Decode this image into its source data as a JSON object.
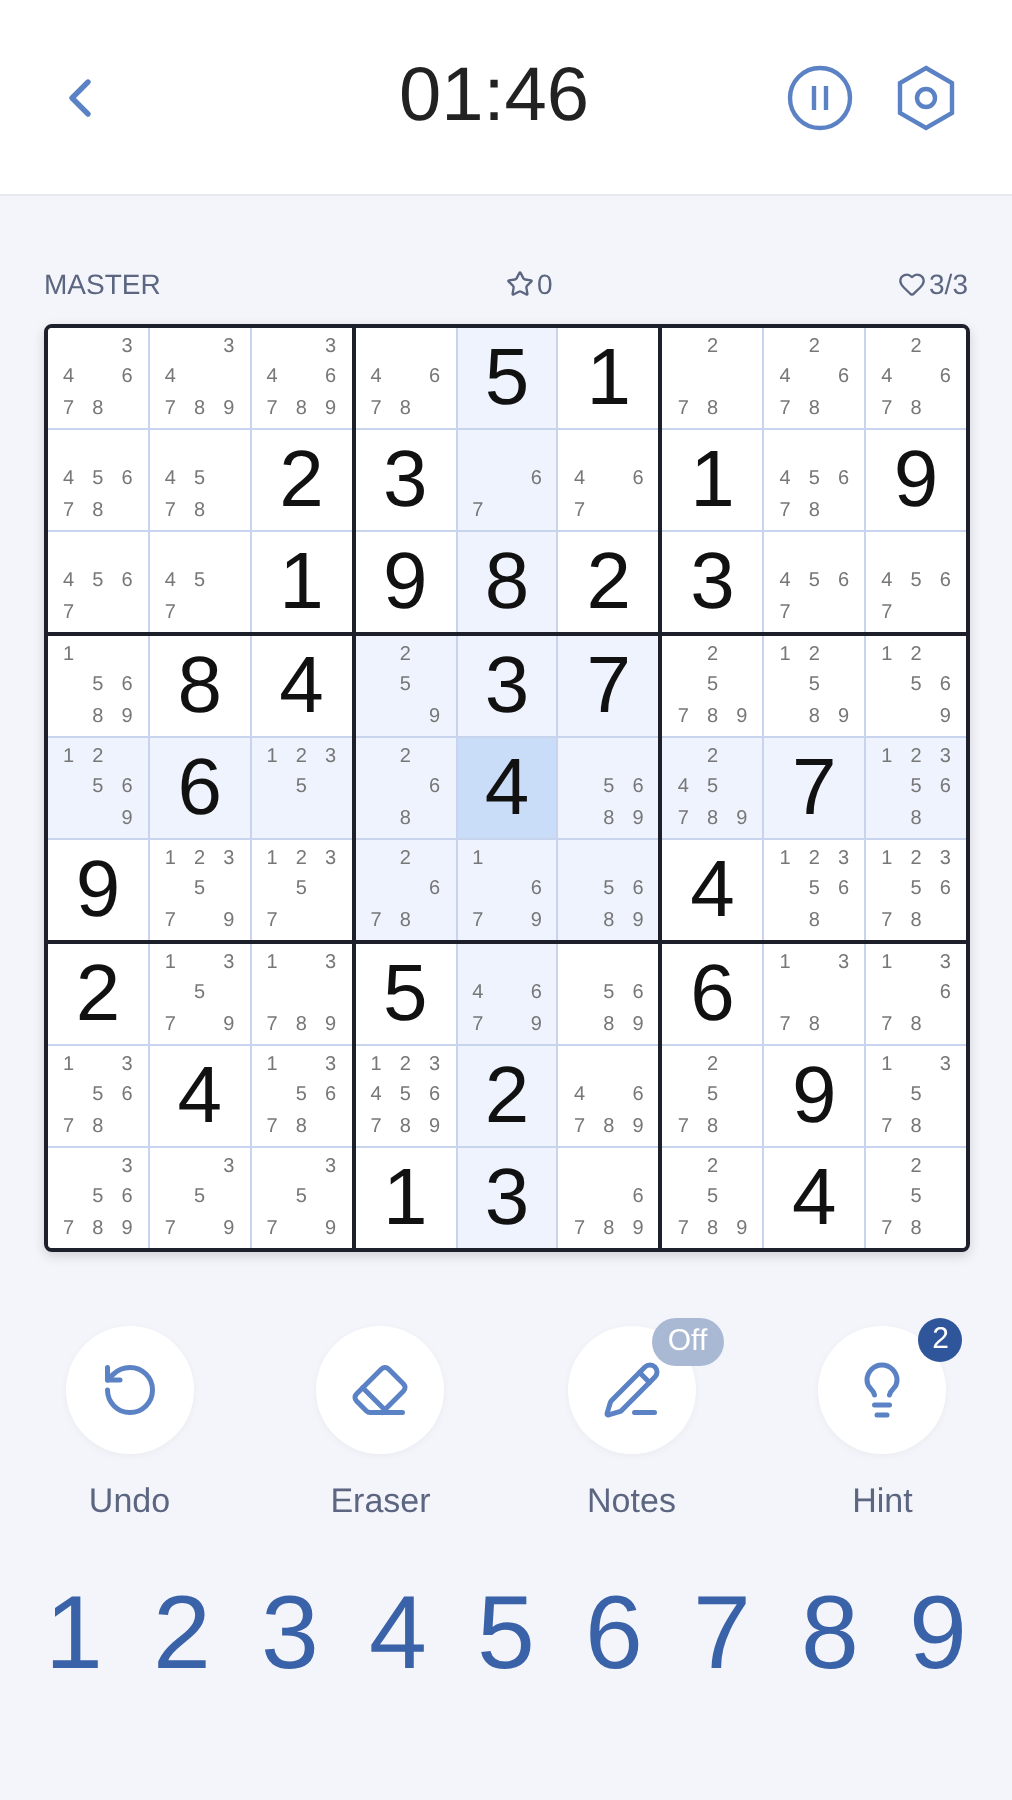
{
  "header": {
    "timer": "01:46"
  },
  "info": {
    "difficulty": "MASTER",
    "stars": "0",
    "lives": "3/3"
  },
  "board": {
    "rows": [
      {
        "cells": [
          {
            "notes": [
              "3",
              "4",
              "6",
              "7",
              "8"
            ],
            "highlighted": false,
            "selected": false
          },
          {
            "notes": [
              "3",
              "4",
              "7",
              "8",
              "9"
            ],
            "highlighted": false,
            "selected": false
          },
          {
            "notes": [
              "3",
              "4",
              "6",
              "7",
              "8",
              "9"
            ],
            "highlighted": false,
            "selected": false
          },
          {
            "notes": [
              "4",
              "6",
              "7",
              "8"
            ],
            "highlighted": false,
            "selected": false
          },
          {
            "value": "5",
            "highlighted": true,
            "selected": false
          },
          {
            "value": "1",
            "highlighted": false,
            "selected": false
          },
          {
            "notes": [
              "2",
              "7",
              "8"
            ],
            "highlighted": false,
            "selected": false
          },
          {
            "notes": [
              "2",
              "4",
              "6",
              "7",
              "8"
            ],
            "highlighted": false,
            "selected": false
          },
          {
            "notes": [
              "2",
              "4",
              "6",
              "7",
              "8"
            ],
            "highlighted": false,
            "selected": false
          }
        ]
      },
      {
        "cells": [
          {
            "notes": [
              "4",
              "5",
              "6",
              "7",
              "8"
            ],
            "highlighted": false,
            "selected": false
          },
          {
            "notes": [
              "4",
              "5",
              "7",
              "8"
            ],
            "highlighted": false,
            "selected": false
          },
          {
            "value": "2",
            "highlighted": false,
            "selected": false
          },
          {
            "value": "3",
            "highlighted": false,
            "selected": false
          },
          {
            "notes": [
              "6",
              "7"
            ],
            "highlighted": true,
            "selected": false
          },
          {
            "notes": [
              "4",
              "6",
              "7"
            ],
            "highlighted": false,
            "selected": false
          },
          {
            "value": "1",
            "highlighted": false,
            "selected": false
          },
          {
            "notes": [
              "4",
              "5",
              "6",
              "7",
              "8"
            ],
            "highlighted": false,
            "selected": false
          },
          {
            "value": "9",
            "highlighted": false,
            "selected": false
          }
        ]
      },
      {
        "cells": [
          {
            "notes": [
              "4",
              "5",
              "6",
              "7"
            ],
            "highlighted": false,
            "selected": false
          },
          {
            "notes": [
              "4",
              "5",
              "7"
            ],
            "highlighted": false,
            "selected": false
          },
          {
            "value": "1",
            "highlighted": false,
            "selected": false
          },
          {
            "value": "9",
            "highlighted": false,
            "selected": false
          },
          {
            "value": "8",
            "highlighted": true,
            "selected": false
          },
          {
            "value": "2",
            "highlighted": false,
            "selected": false
          },
          {
            "value": "3",
            "highlighted": false,
            "selected": false
          },
          {
            "notes": [
              "4",
              "5",
              "6",
              "7"
            ],
            "highlighted": false,
            "selected": false
          },
          {
            "notes": [
              "4",
              "5",
              "6",
              "7"
            ],
            "highlighted": false,
            "selected": false
          }
        ]
      },
      {
        "cells": [
          {
            "notes": [
              "1",
              "5",
              "6",
              "8",
              "9"
            ],
            "highlighted": false,
            "selected": false
          },
          {
            "value": "8",
            "highlighted": false,
            "selected": false
          },
          {
            "value": "4",
            "highlighted": false,
            "selected": false
          },
          {
            "notes": [
              "2",
              "5",
              "9"
            ],
            "highlighted": true,
            "selected": false
          },
          {
            "value": "3",
            "highlighted": true,
            "selected": false
          },
          {
            "value": "7",
            "highlighted": true,
            "selected": false
          },
          {
            "notes": [
              "2",
              "5",
              "7",
              "8",
              "9"
            ],
            "highlighted": false,
            "selected": false
          },
          {
            "notes": [
              "1",
              "2",
              "5",
              "8",
              "9"
            ],
            "highlighted": false,
            "selected": false
          },
          {
            "notes": [
              "1",
              "2",
              "5",
              "6",
              "9"
            ],
            "highlighted": false,
            "selected": false
          }
        ]
      },
      {
        "cells": [
          {
            "notes": [
              "1",
              "2",
              "5",
              "6",
              "9"
            ],
            "highlighted": true,
            "selected": false
          },
          {
            "value": "6",
            "highlighted": true,
            "selected": false
          },
          {
            "notes": [
              "1",
              "2",
              "3",
              "5"
            ],
            "highlighted": true,
            "selected": false
          },
          {
            "notes": [
              "2",
              "6",
              "8"
            ],
            "highlighted": true,
            "selected": false
          },
          {
            "value": "4",
            "highlighted": true,
            "selected": true
          },
          {
            "notes": [
              "5",
              "6",
              "8",
              "9"
            ],
            "highlighted": true,
            "selected": false
          },
          {
            "notes": [
              "2",
              "4",
              "5",
              "7",
              "8",
              "9"
            ],
            "highlighted": true,
            "selected": false
          },
          {
            "value": "7",
            "highlighted": true,
            "selected": false
          },
          {
            "notes": [
              "1",
              "2",
              "3",
              "5",
              "6",
              "8"
            ],
            "highlighted": true,
            "selected": false
          }
        ]
      },
      {
        "cells": [
          {
            "value": "9",
            "highlighted": false,
            "selected": false
          },
          {
            "notes": [
              "1",
              "2",
              "3",
              "5",
              "7",
              "9"
            ],
            "highlighted": false,
            "selected": false
          },
          {
            "notes": [
              "1",
              "2",
              "3",
              "5",
              "7"
            ],
            "highlighted": false,
            "selected": false
          },
          {
            "notes": [
              "2",
              "6",
              "7",
              "8"
            ],
            "highlighted": true,
            "selected": false
          },
          {
            "notes": [
              "1",
              "6",
              "7",
              "9"
            ],
            "highlighted": true,
            "selected": false
          },
          {
            "notes": [
              "5",
              "6",
              "8",
              "9"
            ],
            "highlighted": true,
            "selected": false
          },
          {
            "value": "4",
            "highlighted": false,
            "selected": false
          },
          {
            "notes": [
              "1",
              "2",
              "3",
              "5",
              "6",
              "8"
            ],
            "highlighted": false,
            "selected": false
          },
          {
            "notes": [
              "1",
              "2",
              "3",
              "5",
              "6",
              "7",
              "8"
            ],
            "highlighted": false,
            "selected": false
          }
        ]
      },
      {
        "cells": [
          {
            "value": "2",
            "highlighted": false,
            "selected": false
          },
          {
            "notes": [
              "1",
              "3",
              "5",
              "7",
              "9"
            ],
            "highlighted": false,
            "selected": false
          },
          {
            "notes": [
              "1",
              "3",
              "7",
              "8",
              "9"
            ],
            "highlighted": false,
            "selected": false
          },
          {
            "value": "5",
            "highlighted": false,
            "selected": false
          },
          {
            "notes": [
              "4",
              "6",
              "7",
              "9"
            ],
            "highlighted": true,
            "selected": false
          },
          {
            "notes": [
              "5",
              "6",
              "8",
              "9"
            ],
            "highlighted": false,
            "selected": false
          },
          {
            "value": "6",
            "highlighted": false,
            "selected": false
          },
          {
            "notes": [
              "1",
              "3",
              "7",
              "8"
            ],
            "highlighted": false,
            "selected": false
          },
          {
            "notes": [
              "1",
              "3",
              "6",
              "7",
              "8"
            ],
            "highlighted": false,
            "selected": false
          }
        ]
      },
      {
        "cells": [
          {
            "notes": [
              "1",
              "3",
              "5",
              "6",
              "7",
              "8"
            ],
            "highlighted": false,
            "selected": false
          },
          {
            "value": "4",
            "highlighted": false,
            "selected": false
          },
          {
            "notes": [
              "1",
              "3",
              "5",
              "6",
              "7",
              "8"
            ],
            "highlighted": false,
            "selected": false
          },
          {
            "notes": [
              "1",
              "2",
              "3",
              "4",
              "5",
              "6",
              "7",
              "8",
              "9"
            ],
            "highlighted": false,
            "selected": false
          },
          {
            "value": "2",
            "highlighted": true,
            "selected": false
          },
          {
            "notes": [
              "4",
              "6",
              "7",
              "8",
              "9"
            ],
            "highlighted": false,
            "selected": false
          },
          {
            "notes": [
              "2",
              "5",
              "7",
              "8"
            ],
            "highlighted": false,
            "selected": false
          },
          {
            "value": "9",
            "highlighted": false,
            "selected": false
          },
          {
            "notes": [
              "1",
              "3",
              "5",
              "7",
              "8"
            ],
            "highlighted": false,
            "selected": false
          }
        ]
      },
      {
        "cells": [
          {
            "notes": [
              "3",
              "5",
              "6",
              "7",
              "8",
              "9"
            ],
            "highlighted": false,
            "selected": false
          },
          {
            "notes": [
              "3",
              "5",
              "7",
              "9"
            ],
            "highlighted": false,
            "selected": false
          },
          {
            "notes": [
              "3",
              "5",
              "7",
              "9"
            ],
            "highlighted": false,
            "selected": false
          },
          {
            "value": "1",
            "highlighted": false,
            "selected": false
          },
          {
            "value": "3",
            "highlighted": true,
            "selected": false
          },
          {
            "notes": [
              "6",
              "7",
              "8",
              "9"
            ],
            "highlighted": false,
            "selected": false
          },
          {
            "notes": [
              "2",
              "5",
              "7",
              "8",
              "9"
            ],
            "highlighted": false,
            "selected": false
          },
          {
            "value": "4",
            "highlighted": false,
            "selected": false
          },
          {
            "notes": [
              "2",
              "5",
              "7",
              "8"
            ],
            "highlighted": false,
            "selected": false
          }
        ]
      }
    ]
  },
  "tools": [
    {
      "kind": "undo",
      "label": "Undo"
    },
    {
      "kind": "eraser",
      "label": "Eraser"
    },
    {
      "kind": "notes",
      "label": "Notes",
      "badge": "Off"
    },
    {
      "kind": "hint",
      "label": "Hint",
      "badge": "2"
    }
  ],
  "number_pad": [
    "1",
    "2",
    "3",
    "4",
    "5",
    "6",
    "7",
    "8",
    "9"
  ]
}
